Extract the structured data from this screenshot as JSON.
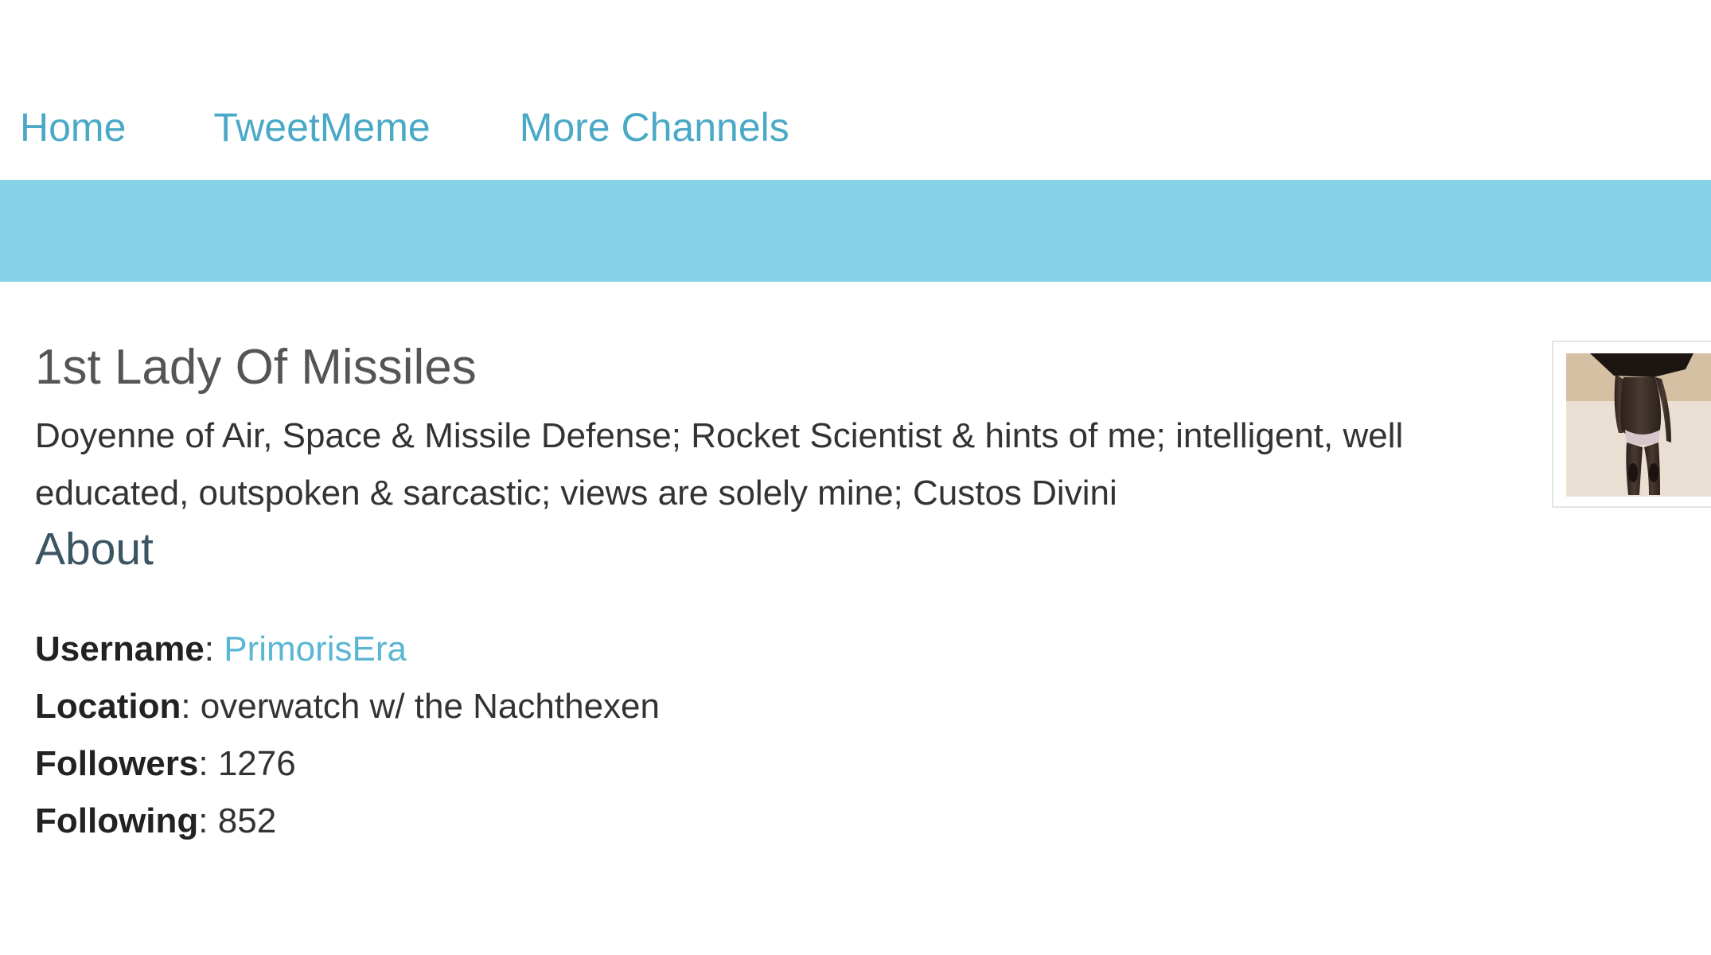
{
  "nav": {
    "items": [
      "Home",
      "TweetMeme",
      "More Channels"
    ]
  },
  "profile": {
    "name": "1st Lady Of Missiles",
    "bio": "Doyenne of Air, Space & Missile Defense; Rocket Scientist & hints of me; intelligent, well educated, outspoken & sarcastic; views are solely mine; Custos Divini",
    "about_heading": "About",
    "details": {
      "username_label": "Username",
      "username": "PrimorisEra",
      "location_label": "Location",
      "location": "overwatch w/ the Nachthexen",
      "followers_label": "Followers",
      "followers": "1276",
      "following_label": "Following",
      "following": "852"
    },
    "avatar_icon": "profile-photo"
  },
  "colors": {
    "link": "#4aa9c6",
    "banner": "#87d2e8",
    "heading": "#555555"
  }
}
